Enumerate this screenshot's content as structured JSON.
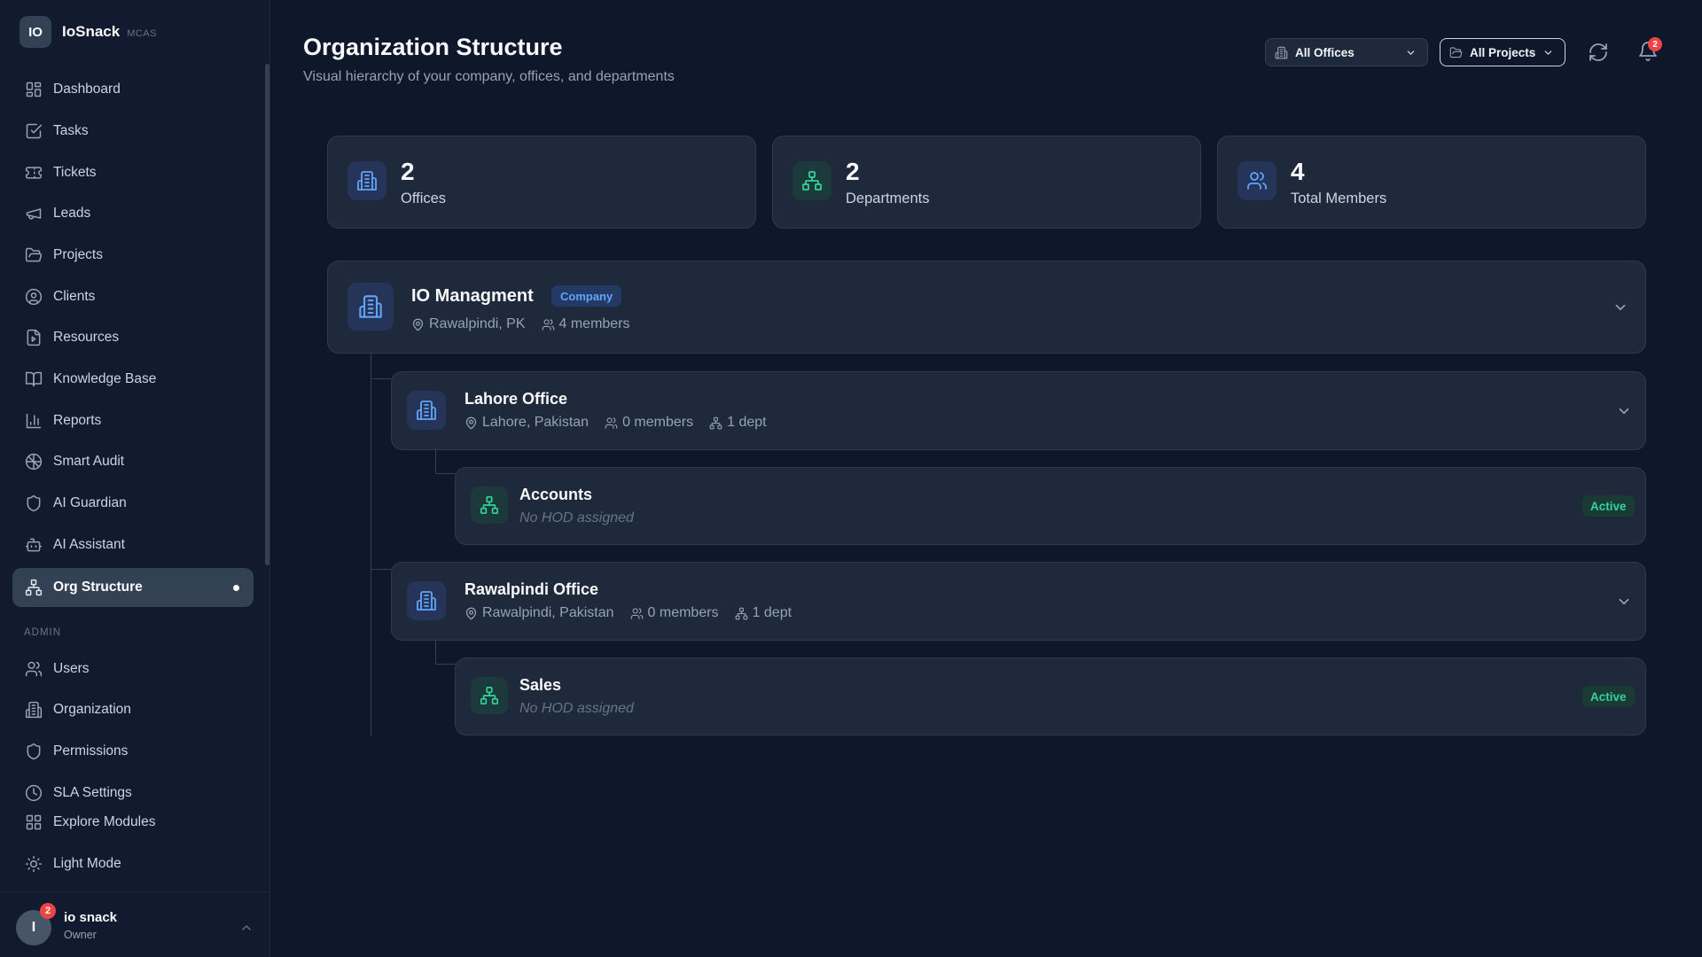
{
  "brand": {
    "logo": "IO",
    "name": "IoSnack",
    "tag": "MCAS"
  },
  "sidebar": {
    "items": [
      {
        "label": "Dashboard",
        "icon": "dashboard-icon"
      },
      {
        "label": "Tasks",
        "icon": "tasks-icon"
      },
      {
        "label": "Tickets",
        "icon": "ticket-icon"
      },
      {
        "label": "Leads",
        "icon": "megaphone-icon"
      },
      {
        "label": "Projects",
        "icon": "folder-icon"
      },
      {
        "label": "Clients",
        "icon": "user-circle-icon"
      },
      {
        "label": "Resources",
        "icon": "file-icon"
      },
      {
        "label": "Knowledge Base",
        "icon": "book-icon"
      },
      {
        "label": "Reports",
        "icon": "bar-chart-icon"
      },
      {
        "label": "Smart Audit",
        "icon": "brain-icon"
      },
      {
        "label": "AI Guardian",
        "icon": "shield-icon"
      },
      {
        "label": "AI Assistant",
        "icon": "bot-icon"
      },
      {
        "label": "Org Structure",
        "icon": "network-icon",
        "active": true
      }
    ],
    "admin_label": "ADMIN",
    "admin_items": [
      {
        "label": "Users",
        "icon": "users-icon"
      },
      {
        "label": "Organization",
        "icon": "building-icon"
      },
      {
        "label": "Permissions",
        "icon": "shield-icon"
      },
      {
        "label": "SLA Settings",
        "icon": "clock-icon"
      },
      {
        "label": "Explore Modules",
        "icon": "grid-icon"
      },
      {
        "label": "Light Mode",
        "icon": "sun-icon"
      }
    ]
  },
  "user": {
    "initial": "I",
    "name": "io snack",
    "role": "Owner",
    "badge": "2"
  },
  "header": {
    "title": "Organization Structure",
    "subtitle": "Visual hierarchy of your company, offices, and departments",
    "offices_filter": "All Offices",
    "projects_filter": "All Projects",
    "notifications": "2"
  },
  "stats": [
    {
      "value": "2",
      "label": "Offices"
    },
    {
      "value": "2",
      "label": "Departments"
    },
    {
      "value": "4",
      "label": "Total Members"
    }
  ],
  "company": {
    "name": "IO Managment",
    "tag": "Company",
    "location": "Rawalpindi, PK",
    "members": "4 members"
  },
  "offices": [
    {
      "name": "Lahore Office",
      "location": "Lahore, Pakistan",
      "members": "0 members",
      "depts": "1 dept",
      "department": {
        "name": "Accounts",
        "hod": "No HOD assigned",
        "status": "Active"
      }
    },
    {
      "name": "Rawalpindi Office",
      "location": "Rawalpindi, Pakistan",
      "members": "0 members",
      "depts": "1 dept",
      "department": {
        "name": "Sales",
        "hod": "No HOD assigned",
        "status": "Active"
      }
    }
  ],
  "colors": {
    "accent_blue": "#60a5fa",
    "accent_green": "#34d399",
    "background": "#0f172a",
    "card": "#1e293b"
  }
}
